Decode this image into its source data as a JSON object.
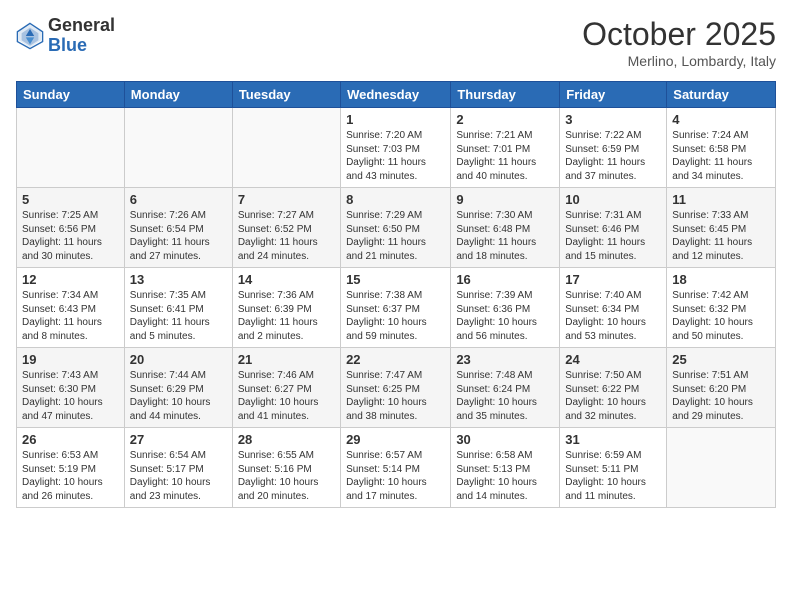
{
  "header": {
    "logo_general": "General",
    "logo_blue": "Blue",
    "month_title": "October 2025",
    "location": "Merlino, Lombardy, Italy"
  },
  "weekdays": [
    "Sunday",
    "Monday",
    "Tuesday",
    "Wednesday",
    "Thursday",
    "Friday",
    "Saturday"
  ],
  "weeks": [
    [
      {
        "day": "",
        "info": ""
      },
      {
        "day": "",
        "info": ""
      },
      {
        "day": "",
        "info": ""
      },
      {
        "day": "1",
        "info": "Sunrise: 7:20 AM\nSunset: 7:03 PM\nDaylight: 11 hours\nand 43 minutes."
      },
      {
        "day": "2",
        "info": "Sunrise: 7:21 AM\nSunset: 7:01 PM\nDaylight: 11 hours\nand 40 minutes."
      },
      {
        "day": "3",
        "info": "Sunrise: 7:22 AM\nSunset: 6:59 PM\nDaylight: 11 hours\nand 37 minutes."
      },
      {
        "day": "4",
        "info": "Sunrise: 7:24 AM\nSunset: 6:58 PM\nDaylight: 11 hours\nand 34 minutes."
      }
    ],
    [
      {
        "day": "5",
        "info": "Sunrise: 7:25 AM\nSunset: 6:56 PM\nDaylight: 11 hours\nand 30 minutes."
      },
      {
        "day": "6",
        "info": "Sunrise: 7:26 AM\nSunset: 6:54 PM\nDaylight: 11 hours\nand 27 minutes."
      },
      {
        "day": "7",
        "info": "Sunrise: 7:27 AM\nSunset: 6:52 PM\nDaylight: 11 hours\nand 24 minutes."
      },
      {
        "day": "8",
        "info": "Sunrise: 7:29 AM\nSunset: 6:50 PM\nDaylight: 11 hours\nand 21 minutes."
      },
      {
        "day": "9",
        "info": "Sunrise: 7:30 AM\nSunset: 6:48 PM\nDaylight: 11 hours\nand 18 minutes."
      },
      {
        "day": "10",
        "info": "Sunrise: 7:31 AM\nSunset: 6:46 PM\nDaylight: 11 hours\nand 15 minutes."
      },
      {
        "day": "11",
        "info": "Sunrise: 7:33 AM\nSunset: 6:45 PM\nDaylight: 11 hours\nand 12 minutes."
      }
    ],
    [
      {
        "day": "12",
        "info": "Sunrise: 7:34 AM\nSunset: 6:43 PM\nDaylight: 11 hours\nand 8 minutes."
      },
      {
        "day": "13",
        "info": "Sunrise: 7:35 AM\nSunset: 6:41 PM\nDaylight: 11 hours\nand 5 minutes."
      },
      {
        "day": "14",
        "info": "Sunrise: 7:36 AM\nSunset: 6:39 PM\nDaylight: 11 hours\nand 2 minutes."
      },
      {
        "day": "15",
        "info": "Sunrise: 7:38 AM\nSunset: 6:37 PM\nDaylight: 10 hours\nand 59 minutes."
      },
      {
        "day": "16",
        "info": "Sunrise: 7:39 AM\nSunset: 6:36 PM\nDaylight: 10 hours\nand 56 minutes."
      },
      {
        "day": "17",
        "info": "Sunrise: 7:40 AM\nSunset: 6:34 PM\nDaylight: 10 hours\nand 53 minutes."
      },
      {
        "day": "18",
        "info": "Sunrise: 7:42 AM\nSunset: 6:32 PM\nDaylight: 10 hours\nand 50 minutes."
      }
    ],
    [
      {
        "day": "19",
        "info": "Sunrise: 7:43 AM\nSunset: 6:30 PM\nDaylight: 10 hours\nand 47 minutes."
      },
      {
        "day": "20",
        "info": "Sunrise: 7:44 AM\nSunset: 6:29 PM\nDaylight: 10 hours\nand 44 minutes."
      },
      {
        "day": "21",
        "info": "Sunrise: 7:46 AM\nSunset: 6:27 PM\nDaylight: 10 hours\nand 41 minutes."
      },
      {
        "day": "22",
        "info": "Sunrise: 7:47 AM\nSunset: 6:25 PM\nDaylight: 10 hours\nand 38 minutes."
      },
      {
        "day": "23",
        "info": "Sunrise: 7:48 AM\nSunset: 6:24 PM\nDaylight: 10 hours\nand 35 minutes."
      },
      {
        "day": "24",
        "info": "Sunrise: 7:50 AM\nSunset: 6:22 PM\nDaylight: 10 hours\nand 32 minutes."
      },
      {
        "day": "25",
        "info": "Sunrise: 7:51 AM\nSunset: 6:20 PM\nDaylight: 10 hours\nand 29 minutes."
      }
    ],
    [
      {
        "day": "26",
        "info": "Sunrise: 6:53 AM\nSunset: 5:19 PM\nDaylight: 10 hours\nand 26 minutes."
      },
      {
        "day": "27",
        "info": "Sunrise: 6:54 AM\nSunset: 5:17 PM\nDaylight: 10 hours\nand 23 minutes."
      },
      {
        "day": "28",
        "info": "Sunrise: 6:55 AM\nSunset: 5:16 PM\nDaylight: 10 hours\nand 20 minutes."
      },
      {
        "day": "29",
        "info": "Sunrise: 6:57 AM\nSunset: 5:14 PM\nDaylight: 10 hours\nand 17 minutes."
      },
      {
        "day": "30",
        "info": "Sunrise: 6:58 AM\nSunset: 5:13 PM\nDaylight: 10 hours\nand 14 minutes."
      },
      {
        "day": "31",
        "info": "Sunrise: 6:59 AM\nSunset: 5:11 PM\nDaylight: 10 hours\nand 11 minutes."
      },
      {
        "day": "",
        "info": ""
      }
    ]
  ]
}
